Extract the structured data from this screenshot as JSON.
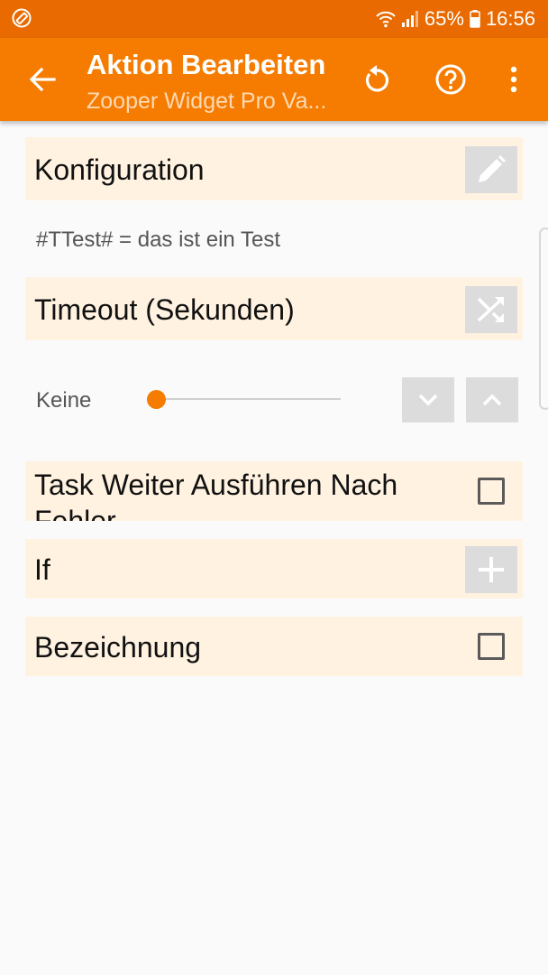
{
  "status_bar": {
    "battery_percent": "65%",
    "time": "16:56",
    "icons": [
      "screen-rotate-icon",
      "wifi-icon",
      "signal-icon",
      "battery-icon"
    ]
  },
  "app_bar": {
    "title": "Aktion Bearbeiten",
    "subtitle": "Zooper Widget Pro Va...",
    "icons": [
      "back-arrow-icon",
      "undo-icon",
      "help-icon",
      "more-vert-icon"
    ]
  },
  "config": {
    "label": "Konfiguration",
    "value": "#TTest# = das ist ein Test",
    "button_icon": "pencil-icon"
  },
  "timeout": {
    "label": "Timeout (Sekunden)",
    "button_icon": "shuffle-icon",
    "slider_value_label": "Keine",
    "slider_level": 0
  },
  "continue_on_error": {
    "label": "Task Weiter Ausführen Nach Fehler",
    "checked": false
  },
  "if": {
    "label": "If",
    "button_icon": "plus-icon"
  },
  "name": {
    "label": "Bezeichnung",
    "checked": false
  },
  "colors": {
    "accent": "#f57c00",
    "status_bar": "#e86a00",
    "row_background": "#fff2e1"
  }
}
